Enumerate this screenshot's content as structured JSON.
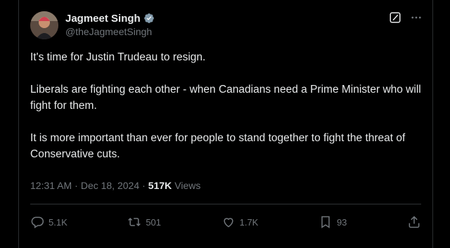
{
  "author": {
    "display_name": "Jagmeet Singh",
    "handle": "@theJagmeetSingh",
    "verified_icon": "verified-badge-icon",
    "avatar": "avatar-photo"
  },
  "top_actions": {
    "grok_icon": "grok-icon",
    "more_icon": "more-icon"
  },
  "tweet": {
    "paragraphs": [
      "It's time for Justin Trudeau to resign.",
      "Liberals are fighting each other - when Canadians need a Prime Minister who will fight for them.",
      "It is more important than ever for people to stand together to fight the threat of Conservative cuts."
    ]
  },
  "meta": {
    "time": "12:31 AM",
    "separator1": "·",
    "date": "Dec 18, 2024",
    "separator2": "·",
    "views_count": "517K",
    "views_label": "Views"
  },
  "actions": {
    "replies": "5.1K",
    "reposts": "501",
    "likes": "1.7K",
    "bookmarks": "93"
  },
  "colors": {
    "background": "#000000",
    "text_primary": "#e7e9ea",
    "text_secondary": "#71767b",
    "verified": "#829aab",
    "divider": "#2f3336"
  }
}
